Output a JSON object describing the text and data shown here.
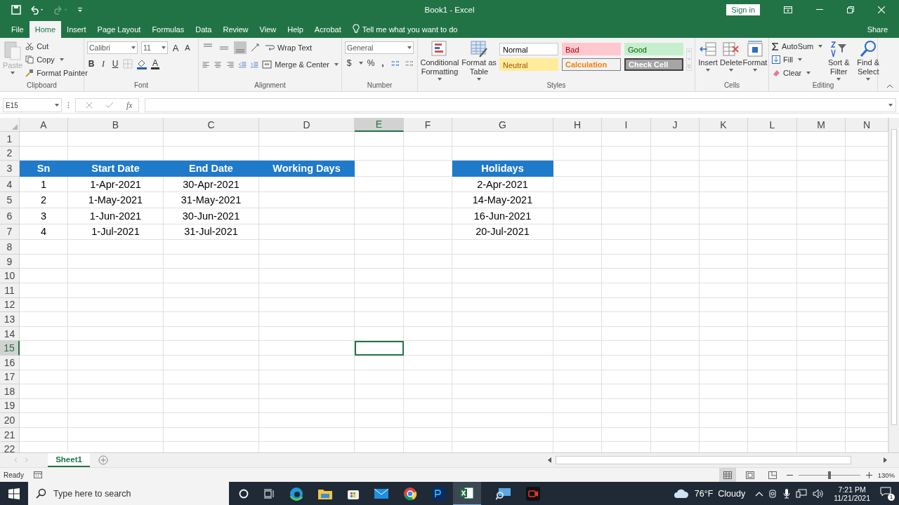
{
  "title_bar": {
    "title": "Book1 - Excel",
    "sign_in": "Sign in",
    "share": "Share"
  },
  "tabs": [
    {
      "label": "File",
      "selected": false
    },
    {
      "label": "Home",
      "selected": true
    },
    {
      "label": "Insert",
      "selected": false
    },
    {
      "label": "Page Layout",
      "selected": false
    },
    {
      "label": "Formulas",
      "selected": false
    },
    {
      "label": "Data",
      "selected": false
    },
    {
      "label": "Review",
      "selected": false
    },
    {
      "label": "View",
      "selected": false
    },
    {
      "label": "Help",
      "selected": false
    },
    {
      "label": "Acrobat",
      "selected": false
    }
  ],
  "tell_me": "Tell me what you want to do",
  "ribbon": {
    "clipboard": {
      "label": "Clipboard",
      "paste": "Paste",
      "paste_disabled": true,
      "cut": "Cut",
      "copy": "Copy",
      "format_painter": "Format Painter"
    },
    "font": {
      "label": "Font",
      "font_name": "Calibri",
      "font_size": "11",
      "grow": "A",
      "shrink": "A",
      "bold": "B",
      "italic": "I",
      "underline": "U",
      "font_color": "A"
    },
    "alignment": {
      "label": "Alignment",
      "vertical": [
        {
          "selected": false
        },
        {
          "selected": false
        },
        {
          "selected": true
        }
      ],
      "wrap_text": "Wrap Text",
      "merge_center": "Merge & Center"
    },
    "number": {
      "label": "Number",
      "format": "General",
      "currency": "$",
      "percent": "%",
      "comma": ","
    },
    "styles": {
      "label": "Styles",
      "conditional": "Conditional Formatting",
      "format_table": "Format as Table",
      "cell_styles": [
        {
          "label": "Normal",
          "kind": "normal"
        },
        {
          "label": "Bad",
          "kind": "bad"
        },
        {
          "label": "Good",
          "kind": "good"
        },
        {
          "label": "Neutral",
          "kind": "neutral"
        },
        {
          "label": "Calculation",
          "kind": "calculation"
        },
        {
          "label": "Check Cell",
          "kind": "check"
        }
      ]
    },
    "cells": {
      "label": "Cells",
      "insert": "Insert",
      "delete": "Delete",
      "format": "Format"
    },
    "editing": {
      "label": "Editing",
      "autosum": "AutoSum",
      "fill": "Fill",
      "clear": "Clear",
      "sort_filter": "Sort & Filter",
      "find_select": "Find & Select"
    }
  },
  "formula_bar": {
    "name_box": "E15",
    "fx": "fx"
  },
  "sheet": {
    "columns": [
      {
        "label": "A",
        "selected": false
      },
      {
        "label": "B",
        "selected": false
      },
      {
        "label": "C",
        "selected": false
      },
      {
        "label": "D",
        "selected": false
      },
      {
        "label": "E",
        "selected": true
      },
      {
        "label": "F",
        "selected": false
      },
      {
        "label": "G",
        "selected": false
      },
      {
        "label": "H",
        "selected": false
      },
      {
        "label": "I",
        "selected": false
      },
      {
        "label": "J",
        "selected": false
      },
      {
        "label": "K",
        "selected": false
      },
      {
        "label": "L",
        "selected": false
      },
      {
        "label": "M",
        "selected": false
      },
      {
        "label": "N",
        "selected": false
      }
    ],
    "rows": [
      {
        "label": "1",
        "selected": false
      },
      {
        "label": "2",
        "selected": false
      },
      {
        "label": "3",
        "selected": false,
        "kind": "header",
        "cells": [
          "Sn",
          "Start Date",
          "End Date",
          "Working Days",
          null,
          null,
          "Holidays"
        ]
      },
      {
        "label": "4",
        "selected": false,
        "kind": "data",
        "cells": [
          "1",
          "1-Apr-2021",
          "30-Apr-2021",
          null,
          null,
          null,
          "2-Apr-2021"
        ]
      },
      {
        "label": "5",
        "selected": false,
        "kind": "data",
        "cells": [
          "2",
          "1-May-2021",
          "31-May-2021",
          null,
          null,
          null,
          "14-May-2021"
        ]
      },
      {
        "label": "6",
        "selected": false,
        "kind": "data",
        "cells": [
          "3",
          "1-Jun-2021",
          "30-Jun-2021",
          null,
          null,
          null,
          "16-Jun-2021"
        ]
      },
      {
        "label": "7",
        "selected": false,
        "kind": "data",
        "cells": [
          "4",
          "1-Jul-2021",
          "31-Jul-2021",
          null,
          null,
          null,
          "20-Jul-2021"
        ]
      },
      {
        "label": "8",
        "selected": false
      },
      {
        "label": "9",
        "selected": false
      },
      {
        "label": "10",
        "selected": false
      },
      {
        "label": "11",
        "selected": false
      },
      {
        "label": "12",
        "selected": false
      },
      {
        "label": "13",
        "selected": false
      },
      {
        "label": "14",
        "selected": false
      },
      {
        "label": "15",
        "selected": true
      },
      {
        "label": "16",
        "selected": false
      },
      {
        "label": "17",
        "selected": false
      },
      {
        "label": "18",
        "selected": false
      },
      {
        "label": "19",
        "selected": false
      },
      {
        "label": "20",
        "selected": false
      },
      {
        "label": "21",
        "selected": false
      },
      {
        "label": "22",
        "selected": false
      }
    ]
  },
  "sheet_tabs": [
    {
      "label": "Sheet1",
      "selected": true
    }
  ],
  "status_bar": {
    "status": "Ready",
    "zoom": "130%",
    "zoom_slider": {
      "level": 0.5
    },
    "views": [
      {
        "selected": true
      },
      {
        "selected": false
      },
      {
        "selected": false
      }
    ]
  },
  "taskbar": {
    "search_placeholder": "Type here to search",
    "weather": "76°F  Cloudy",
    "time": "7:21 PM",
    "date": "11/21/2021",
    "notifications": "1"
  }
}
